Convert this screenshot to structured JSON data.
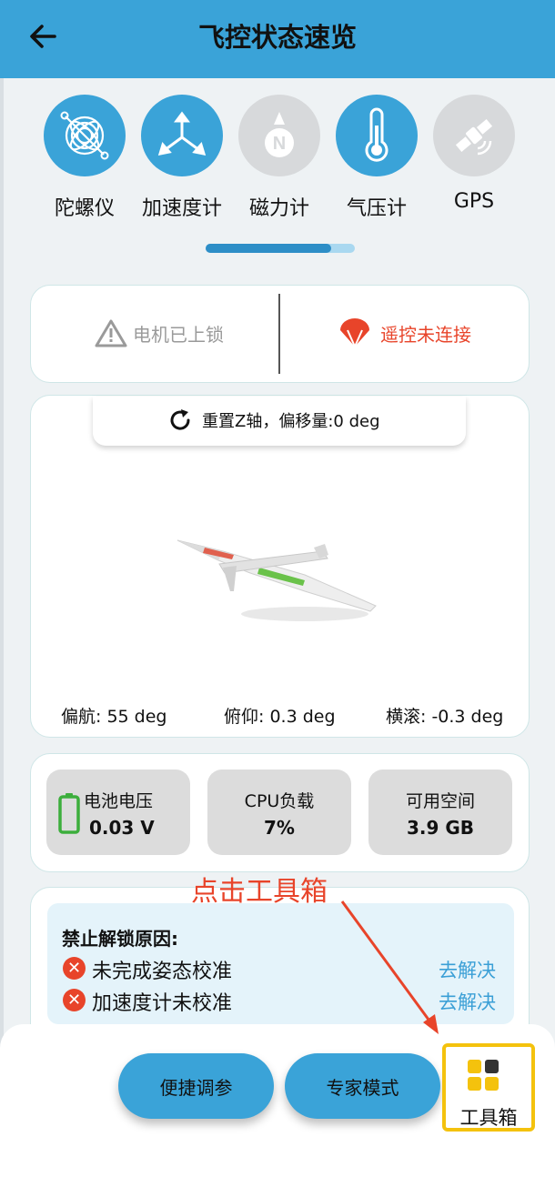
{
  "header": {
    "title": "飞控状态速览"
  },
  "sensors": [
    {
      "label": "陀螺仪",
      "icon": "gyroscope-icon",
      "active": true
    },
    {
      "label": "加速度计",
      "icon": "accelerometer-icon",
      "active": true
    },
    {
      "label": "磁力计",
      "icon": "compass-icon",
      "active": false
    },
    {
      "label": "气压计",
      "icon": "thermometer-icon",
      "active": true
    },
    {
      "label": "GPS",
      "icon": "satellite-icon",
      "active": false
    }
  ],
  "status": {
    "motor": "电机已上锁",
    "remote": "遥控未连接"
  },
  "attitude": {
    "reset_label": "重置Z轴，偏移量:0 deg",
    "yaw": "偏航: 55 deg",
    "pitch": "俯仰: 0.3 deg",
    "roll": "横滚: -0.3 deg"
  },
  "stats": [
    {
      "label": "电池电压",
      "value": "0.03 V"
    },
    {
      "label": "CPU负载",
      "value": "7%"
    },
    {
      "label": "可用空间",
      "value": "3.9 GB"
    }
  ],
  "annotation": "点击工具箱",
  "arming": {
    "title": "禁止解锁原因:",
    "reasons": [
      {
        "text": "未完成姿态校准",
        "action": "去解决"
      },
      {
        "text": "加速度计未校准",
        "action": "去解决"
      }
    ]
  },
  "bottom": {
    "quick_tune": "便捷调参",
    "expert_mode": "专家模式",
    "toolbox": "工具箱"
  },
  "colors": {
    "primary": "#3aa3d8",
    "inactive": "#d7d9db",
    "warning": "#e8442a",
    "highlight": "#f4c20d",
    "battery": "#3cae3c"
  }
}
